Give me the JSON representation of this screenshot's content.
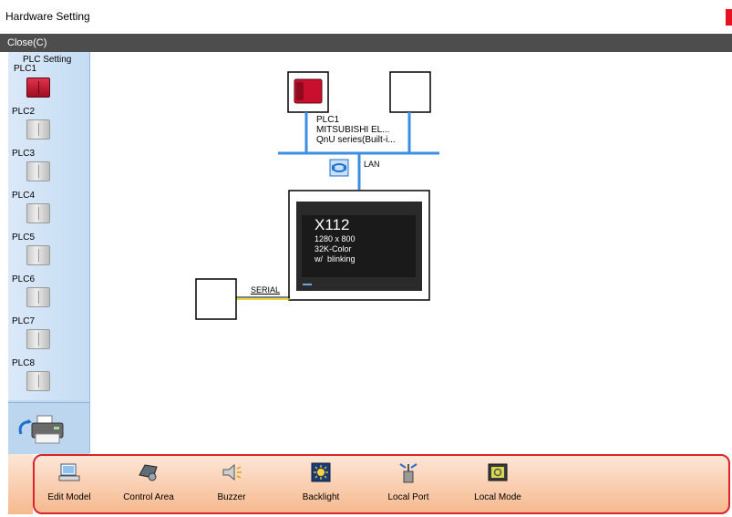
{
  "window": {
    "title": "Hardware Setting"
  },
  "menubar": {
    "close_label": "Close(C)"
  },
  "sidebar": {
    "heading_line1": "PLC Setting",
    "heading_line2": "PLC1",
    "items": [
      {
        "label": "PLC2"
      },
      {
        "label": "PLC3"
      },
      {
        "label": "PLC4"
      },
      {
        "label": "PLC5"
      },
      {
        "label": "PLC6"
      },
      {
        "label": "PLC7"
      },
      {
        "label": "PLC8"
      }
    ],
    "printer_icon": "printer-icon"
  },
  "diagram": {
    "plc_name": "PLC1",
    "plc_maker": "MITSUBISHI EL...",
    "plc_series": "QnU series(Built-i...",
    "lan_label": "LAN",
    "serial_label": "SERIAL",
    "hmi_model": "X112",
    "hmi_resolution": "1280 x 800",
    "hmi_colors": "32K-Color",
    "hmi_blink": "w/  blinking",
    "colors": {
      "lan": "#3b8fe0",
      "serial": "#e6c800",
      "plc_red": "#c8102e"
    }
  },
  "toolbar": {
    "buttons": [
      {
        "label": "Edit Model",
        "icon": "edit-model-icon"
      },
      {
        "label": "Control Area",
        "icon": "control-area-icon"
      },
      {
        "label": "Buzzer",
        "icon": "buzzer-icon"
      },
      {
        "label": "Backlight",
        "icon": "backlight-icon"
      },
      {
        "label": "Local Port",
        "icon": "local-port-icon"
      },
      {
        "label": "Local Mode",
        "icon": "local-mode-icon"
      }
    ]
  }
}
